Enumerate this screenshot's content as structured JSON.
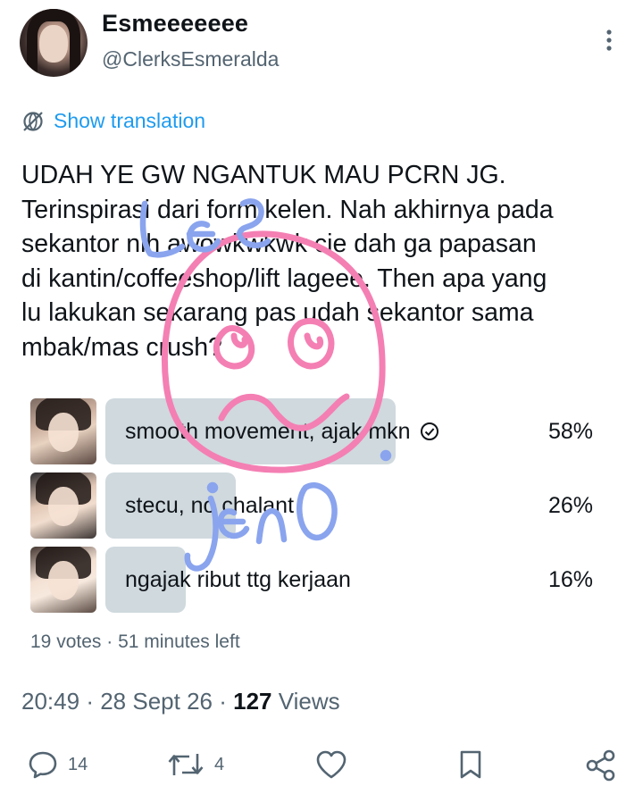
{
  "author": {
    "display_name": "Esmeeeeeee",
    "handle": "@ClerksEsmeralda",
    "avatar_icon": "profile-photo"
  },
  "more_icon": "more-vertical-icon",
  "translation": {
    "label": "Show translation",
    "icon": "translate-globe-icon"
  },
  "tweet": {
    "lines": [
      "UDAH YE GW NGANTUK MAU PCRN JG.",
      "Terinspirasi dari form kelen. Nah akhirnya pada",
      "sekantor nih awowkwkwk cie dah ga papasan",
      "di kantin/coffeeshop/lift lageee. Then apa yang",
      "lu lakukan sekarang pas udah sekantor sama",
      "mbak/mas crush?"
    ]
  },
  "poll": {
    "options": [
      {
        "label": "smooth movement, ajak mkn",
        "percent": "58%",
        "share": 0.58,
        "selected": true,
        "check_icon": "check-circle-icon"
      },
      {
        "label": "stecu, no chalant",
        "percent": "26%",
        "share": 0.26,
        "selected": false
      },
      {
        "label": "ngajak ribut ttg kerjaan",
        "percent": "16%",
        "share": 0.16,
        "selected": false
      }
    ],
    "meta": {
      "votes": "19 votes",
      "separator": "·",
      "time_left": "51 minutes left"
    }
  },
  "timestamp": {
    "time": "20:49",
    "separator": "·",
    "date": "28 Sept 26",
    "views_count": "127",
    "views_label": "Views"
  },
  "actions": {
    "reply": {
      "icon": "reply-bubble-icon",
      "count": "14"
    },
    "retweet": {
      "icon": "retweet-icon",
      "count": "4"
    },
    "like": {
      "icon": "heart-icon"
    },
    "bookmark": {
      "icon": "bookmark-icon"
    },
    "share": {
      "icon": "share-icon"
    }
  },
  "overlay": {
    "scribble_blue_top": "Lee",
    "scribble_blue_bottom": "jeno",
    "colors": {
      "pink": "#f47fb3",
      "blue": "#8aa4ee"
    }
  },
  "colors": {
    "link": "#1d9bf0",
    "muted": "#536471",
    "text": "#0f1419",
    "poll_bar": "#cfd9de"
  }
}
